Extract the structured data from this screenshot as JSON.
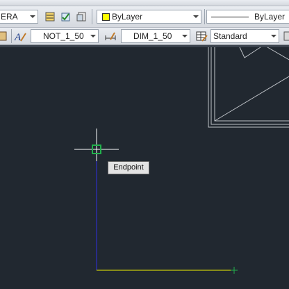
{
  "layer_toolbar": {
    "layer_combo_value": "ERA"
  },
  "properties_toolbar": {
    "color_combo_value": "ByLayer",
    "color_swatch": "#ffff00",
    "linetype_combo_value": "ByLayer"
  },
  "styles_toolbar": {
    "text_style_value": "NOT_1_50",
    "dim_style_value": "DIM_1_50",
    "table_style_value": "Standard"
  },
  "osnap_tooltip": {
    "label": "Endpoint"
  },
  "colors": {
    "canvas_bg": "#212830",
    "osnap_marker": "#22b14c",
    "crosshair": "#ffffff",
    "line_vertical": "#4040ff",
    "line_horizontal": "#ffff00",
    "grid_line": "#bfc3c8"
  }
}
